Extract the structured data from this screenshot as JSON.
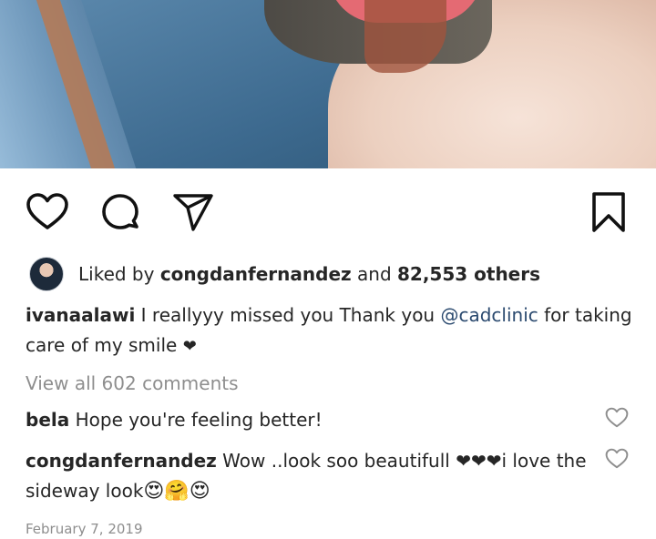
{
  "post": {
    "photo_alt": "photo"
  },
  "actions": {
    "like_icon": "heart-outline-icon",
    "comment_icon": "comment-bubble-icon",
    "share_icon": "paper-plane-icon",
    "save_icon": "bookmark-icon"
  },
  "likes": {
    "prefix": "Liked by ",
    "user": "congdanfernandez",
    "middle": " and ",
    "count": "82,553 others"
  },
  "caption": {
    "username": "ivanaalawi",
    "text_1": " I reallyyy missed you  Thank you ",
    "mention": "@cadclinic",
    "text_2": " for taking care of my smile ",
    "emoji": "❤"
  },
  "view_all": "View all 602 comments",
  "comments": [
    {
      "username": "bela",
      "text": " Hope you're feeling better!"
    },
    {
      "username": "congdanfernandez",
      "text": " Wow ..look soo beautifull ",
      "emoji_hearts": "❤❤❤",
      "text_2": "i love  the sideway look",
      "emoji_tail": "😍🤗😍"
    }
  ],
  "date": "February 7, 2019"
}
